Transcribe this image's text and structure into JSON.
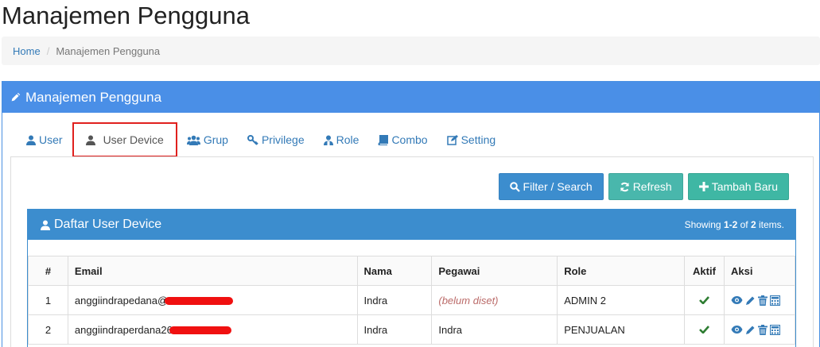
{
  "page": {
    "title": "Manajemen Pengguna"
  },
  "breadcrumb": {
    "home": "Home",
    "separator": "/",
    "current": "Manajemen Pengguna"
  },
  "panel": {
    "heading": "Manajemen Pengguna"
  },
  "tabs": [
    {
      "label": "User",
      "icon": "user-icon"
    },
    {
      "label": "User Device",
      "icon": "user-device-icon",
      "active": true
    },
    {
      "label": "Grup",
      "icon": "group-icon"
    },
    {
      "label": "Privilege",
      "icon": "key-icon"
    },
    {
      "label": "Role",
      "icon": "role-icon"
    },
    {
      "label": "Combo",
      "icon": "book-icon"
    },
    {
      "label": "Setting",
      "icon": "edit-icon"
    }
  ],
  "toolbar": {
    "filter_label": "Filter / Search",
    "refresh_label": "Refresh",
    "add_label": "Tambah Baru"
  },
  "list": {
    "title": "Daftar User Device",
    "summary": {
      "prefix": "Showing ",
      "range": "1-2",
      "of": " of ",
      "total": "2",
      "suffix": " items."
    },
    "columns": [
      "#",
      "Email",
      "Nama",
      "Pegawai",
      "Role",
      "Aktif",
      "Aksi"
    ],
    "rows": [
      {
        "no": "1",
        "email": "anggiindrapedana@",
        "nama": "Indra",
        "pegawai": "(belum diset)",
        "role": "ADMIN 2"
      },
      {
        "no": "2",
        "email": "anggiindraperdana26",
        "nama": "Indra",
        "pegawai": "Indra",
        "role": "PENJUALAN"
      }
    ]
  },
  "colors": {
    "primary": "#3c8dce",
    "heading": "#4a8fe7",
    "check": "#2e7d32",
    "highlight": "#e0201e",
    "redaction": "#f01010"
  }
}
